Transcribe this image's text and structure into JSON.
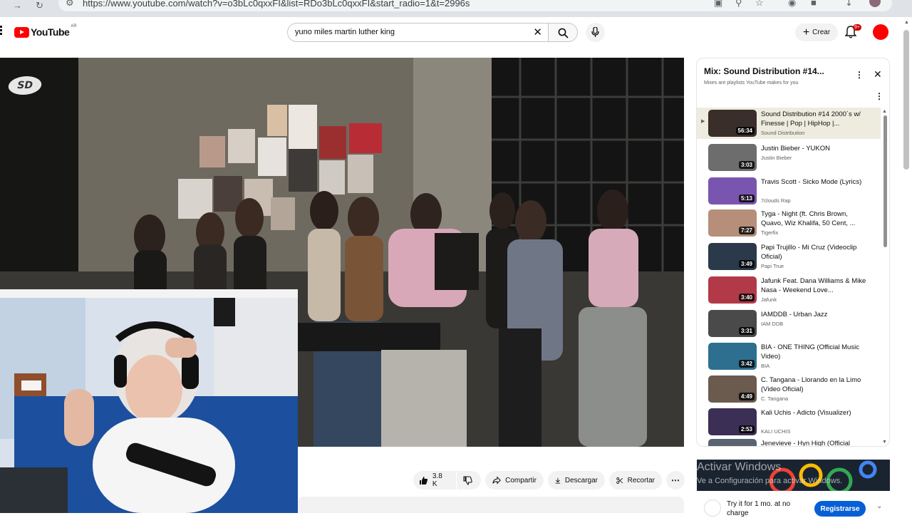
{
  "browser": {
    "url": "https://www.youtube.com/watch?v=o3bLc0qxxFI&list=RDo3bLc0qxxFI&start_radio=1&t=2996s"
  },
  "header": {
    "logo_text": "YouTube",
    "country_code": "AR",
    "search_value": "yuno miles martin luther king",
    "create_label": "Crear",
    "notification_count": "9+"
  },
  "video": {
    "watermark": "SD"
  },
  "actions": {
    "like_count": "3.8 K",
    "share_label": "Compartir",
    "download_label": "Descargar",
    "clip_label": "Recortar"
  },
  "playlist": {
    "title": "Mix: Sound Distribution #14...",
    "subtitle": "Mixes are playlists YouTube makes for you",
    "items": [
      {
        "title": "Sound Distribution #14 2000´s w/ Finesse | Pop | HipHop |...",
        "channel": "Sound Distribution",
        "duration": "56:34"
      },
      {
        "title": "Justin Bieber - YUKON",
        "channel": "Justin Bieber",
        "duration": "3:03"
      },
      {
        "title": "Travis Scott - Sicko Mode (Lyrics)",
        "channel": "7clouds Rap",
        "duration": "5:13"
      },
      {
        "title": "Tyga - Night (ft. Chris Brown, Quavo, Wiz Khalifa, 50 Cent, ...",
        "channel": "Tigerfix",
        "duration": "7:27"
      },
      {
        "title": "Papi Trujillo - Mi Cruz (Videoclip Oficial)",
        "channel": "Papi True",
        "duration": "3:49"
      },
      {
        "title": "Jafunk Feat. Dana Williams & Mike Nasa - Weekend Love...",
        "channel": "Jafunk",
        "duration": "3:40"
      },
      {
        "title": "IAMDDB - Urban Jazz",
        "channel": "IAM DDB",
        "duration": "3:31"
      },
      {
        "title": "BIA - ONE THING (Official Music Video)",
        "channel": "BIA",
        "duration": "3:42"
      },
      {
        "title": "C. Tangana - Llorando en la Limo (Video Oficial)",
        "channel": "C. Tangana",
        "duration": "4:49"
      },
      {
        "title": "Kali Uchis - Adicto (Visualizer)",
        "channel": "KALI UCHIS",
        "duration": "2:53"
      },
      {
        "title": "Jenevieve - Hyn High (Official",
        "channel": "",
        "duration": ""
      }
    ]
  },
  "ad": {
    "text": "Try it for 1 mo. at no charge",
    "button_label": "Registrarse"
  },
  "os_overlay": {
    "heading": "Activar Windows",
    "message": "Ve a Configuración para activar Windows."
  },
  "colors": {
    "brand_red": "#ff0000",
    "active_item_bg": "#eeecdf",
    "cta_blue": "#065fd4"
  }
}
